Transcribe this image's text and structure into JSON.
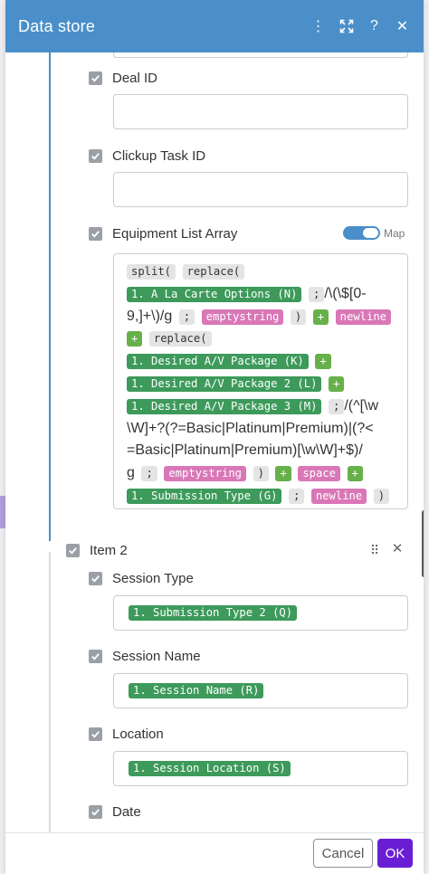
{
  "header": {
    "title": "Data store",
    "menu_icon": "kebab-menu-icon",
    "expand_icon": "expand-icon",
    "help_icon": "help-icon",
    "close_icon": "close-icon",
    "menu_glyph": "⋮",
    "expand_glyph": "⤢",
    "help_glyph": "?",
    "close_glyph": "✕"
  },
  "item1": {
    "deal_id_label": "Deal ID",
    "clickup_task_id_label": "Clickup Task ID",
    "equipment_label": "Equipment List Array",
    "map_label": "Map",
    "map_enabled": true
  },
  "expression": {
    "l1_fn1": "split(",
    "l1_fn2": "replace(",
    "l2_var": "1. A La Carte Options (N)",
    "l2_sep": ";",
    "l2_text": "/\\(\\$[0-",
    "l3_text": "9,]+\\)/g",
    "l3_sep": ";",
    "l3_kw": "emptystring",
    "l3_close": ")",
    "l3_plus": "+",
    "l3_kw2": "newline",
    "l4_plus": "+",
    "l4_fn": "replace(",
    "l5_var": "1. Desired A/V Package (K)",
    "l5_plus": "+",
    "l6_var": "1. Desired A/V Package 2 (L)",
    "l6_plus": "+",
    "l7_var": "1. Desired A/V Package 3 (M)",
    "l7_sep": ";",
    "l7_text": "/(^[\\w",
    "l8_text": "\\W]+?(?=Basic|Platinum|Premium)|(?<",
    "l9_text": "=Basic|Platinum|Premium)[\\w\\W]+$)/",
    "l10_text": "g",
    "l10_sep": ";",
    "l10_kw": "emptystring",
    "l10_close": ")",
    "l10_plus": "+",
    "l10_kw2": "space",
    "l10_plus2": "+",
    "l11_var": "1. Submission Type (G)",
    "l11_sep": ";",
    "l11_kw": "newline",
    "l11_close": ")"
  },
  "item2": {
    "label": "Item 2",
    "drag_icon": "drag-handle-icon",
    "drag_glyph": "⠿",
    "remove_icon": "close-icon",
    "remove_glyph": "✕",
    "session_type_label": "Session Type",
    "session_type_value": "1. Submission Type 2 (Q)",
    "session_name_label": "Session Name",
    "session_name_value": "1. Session Name (R)",
    "location_label": "Location",
    "location_value": "1. Session Location (S)",
    "date_label": "Date"
  },
  "footer": {
    "cancel_label": "Cancel",
    "ok_label": "OK"
  },
  "colors": {
    "header": "#4a8fc9",
    "ok_button": "#6a1ed3",
    "variable_token": "#3d9a5b",
    "operator_token": "#67b04a",
    "keyword_token": "#d977b7"
  }
}
